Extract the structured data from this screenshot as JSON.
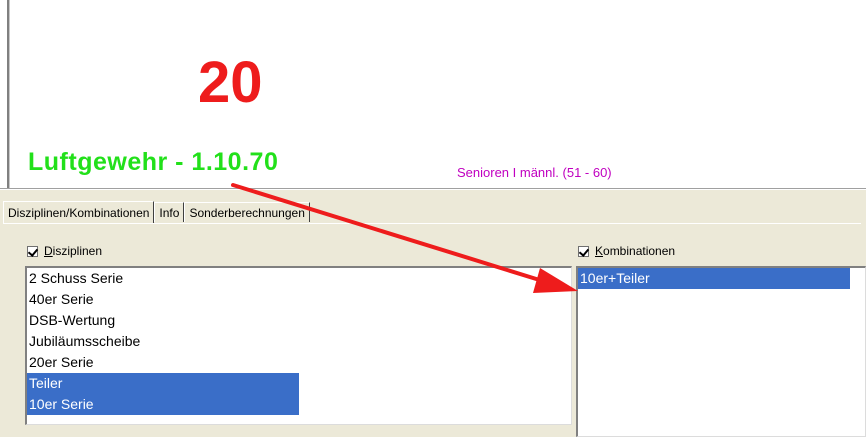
{
  "score": {
    "value": "20"
  },
  "discipline": {
    "title": "Luftgewehr - 1.10.70"
  },
  "class_label": "Senioren I männl. (51 - 60)",
  "tabs": [
    {
      "label": "Disziplinen/Kombinationen",
      "active": true
    },
    {
      "label": "Info",
      "active": false
    },
    {
      "label": "Sonderberechnungen",
      "active": false
    }
  ],
  "disciplines": {
    "header_mnemonic": "D",
    "header_rest": "isziplinen",
    "checked": true,
    "items": [
      {
        "label": "2 Schuss Serie",
        "selected": false
      },
      {
        "label": "40er Serie",
        "selected": false
      },
      {
        "label": "DSB-Wertung",
        "selected": false
      },
      {
        "label": "Jubiläumsscheibe",
        "selected": false
      },
      {
        "label": "20er Serie",
        "selected": false
      },
      {
        "label": "Teiler",
        "selected": true
      },
      {
        "label": "10er Serie",
        "selected": true
      }
    ]
  },
  "combinations": {
    "header_mnemonic": "K",
    "header_rest": "ombinationen",
    "checked": true,
    "items": [
      {
        "label": "10er+Teiler",
        "selected": true
      }
    ]
  },
  "colors": {
    "score": "#ee1c1c",
    "discipline_title": "#22e01a",
    "class_label": "#c000c0",
    "selection": "#3a6ec8",
    "annotation_arrow": "#ee1c1c"
  }
}
